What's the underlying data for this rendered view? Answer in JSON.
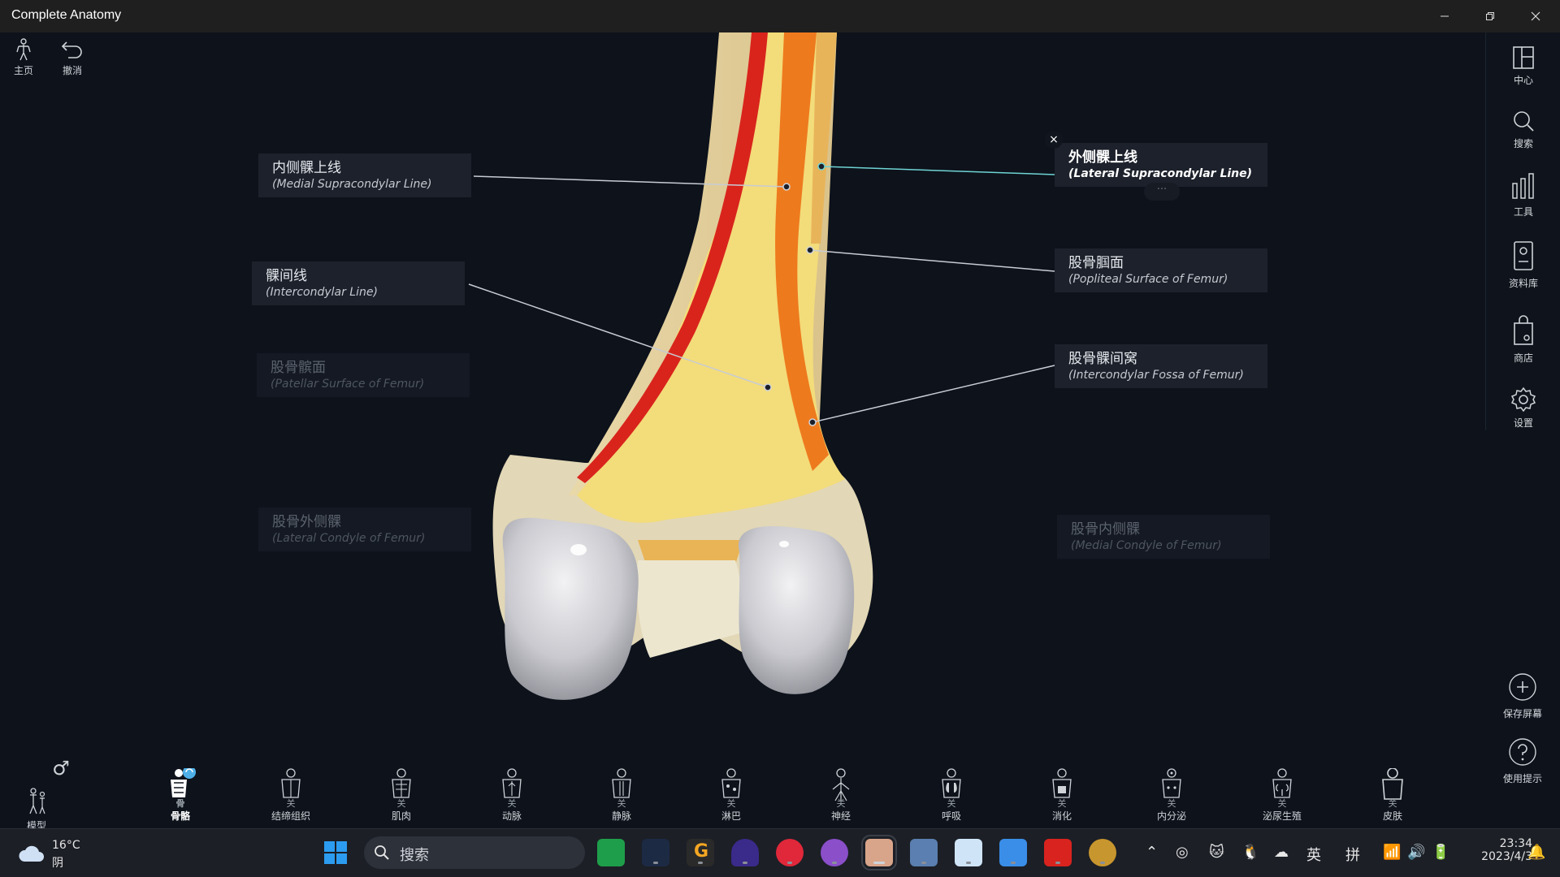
{
  "window": {
    "title": "Complete Anatomy"
  },
  "toolbar": {
    "home_label": "主页",
    "undo_label": "撤消"
  },
  "right_rail": {
    "items": [
      "中心",
      "搜索",
      "工具",
      "资料库",
      "商店",
      "设置"
    ]
  },
  "side_actions": {
    "save_screen": "保存屏幕",
    "tips": "使用提示"
  },
  "labels": [
    {
      "zh": "内侧髁上线",
      "en": "(Medial Supracondylar Line)",
      "state": "normal"
    },
    {
      "zh": "外侧髁上线",
      "en": "(Lateral Supracondylar Line)",
      "state": "active"
    },
    {
      "zh": "髁间线",
      "en": "(Intercondylar Line)",
      "state": "normal"
    },
    {
      "zh": "股骨腘面",
      "en": "(Popliteal Surface of Femur)",
      "state": "normal"
    },
    {
      "zh": "股骨髌面",
      "en": "(Patellar Surface of Femur)",
      "state": "dim"
    },
    {
      "zh": "股骨髁间窝",
      "en": "(Intercondylar Fossa of Femur)",
      "state": "normal"
    },
    {
      "zh": "股骨外侧髁",
      "en": "(Lateral Condyle of Femur)",
      "state": "dim"
    },
    {
      "zh": "股骨内侧髁",
      "en": "(Medial Condyle of Femur)",
      "state": "dim"
    }
  ],
  "label_controls": {
    "close": "×",
    "more": "···"
  },
  "systems": {
    "model_label": "模型",
    "gender_symbol": "♂",
    "items": [
      {
        "label": "骨骼",
        "active": true,
        "off": "骨"
      },
      {
        "label": "结缔组织",
        "active": false,
        "off": "关"
      },
      {
        "label": "肌肉",
        "active": false,
        "off": "关"
      },
      {
        "label": "动脉",
        "active": false,
        "off": "关"
      },
      {
        "label": "静脉",
        "active": false,
        "off": "关"
      },
      {
        "label": "淋巴",
        "active": false,
        "off": "关"
      },
      {
        "label": "神经",
        "active": false,
        "off": "关"
      },
      {
        "label": "呼吸",
        "active": false,
        "off": "关"
      },
      {
        "label": "消化",
        "active": false,
        "off": "关"
      },
      {
        "label": "内分泌",
        "active": false,
        "off": "关"
      },
      {
        "label": "泌尿生殖",
        "active": false,
        "off": "关"
      },
      {
        "label": "皮肤",
        "active": false,
        "off": "关"
      }
    ]
  },
  "taskbar": {
    "weather_temp": "16°C",
    "weather_desc": "阴",
    "search_placeholder": "搜索",
    "ime_lang": "英",
    "ime_mode": "拼",
    "time": "23:34",
    "date": "2023/4/3"
  },
  "colors": {
    "accent": "#4fb0e8",
    "line_active": "#6fd3d3",
    "bone": "#f2d98a",
    "marker_red": "#d9241c",
    "marker_orange": "#ee7a1e"
  }
}
